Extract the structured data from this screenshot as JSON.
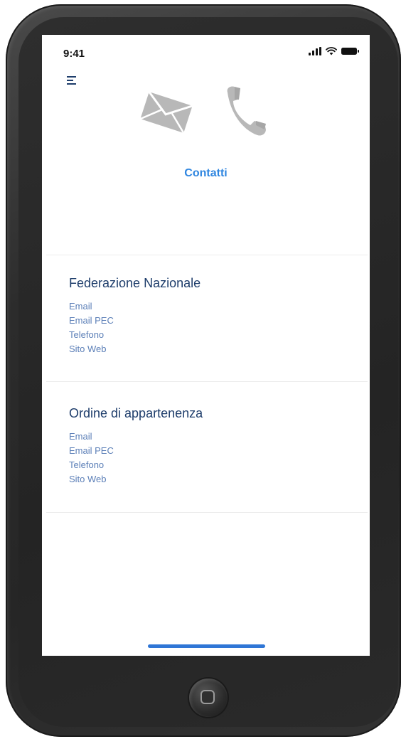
{
  "status_bar": {
    "time": "9:41",
    "icons": [
      "signal-icon",
      "wifi-icon",
      "battery-icon"
    ]
  },
  "header": {
    "menu_icon": "menu-icon",
    "hero_icons": [
      "envelope-icon",
      "phone-icon"
    ],
    "title": "Contatti"
  },
  "sections": [
    {
      "title": "Federazione Nazionale",
      "links": [
        "Email",
        "Email PEC",
        "Telefono",
        "Sito Web"
      ]
    },
    {
      "title": "Ordine di appartenenza",
      "links": [
        "Email",
        "Email PEC",
        "Telefono",
        "Sito Web"
      ]
    }
  ],
  "colors": {
    "accent": "#2f86e0",
    "section_title": "#1e3d6b",
    "link": "#5d80b8",
    "icon_gray": "#b8b8b8",
    "home_indicator": "#2f76d6"
  }
}
